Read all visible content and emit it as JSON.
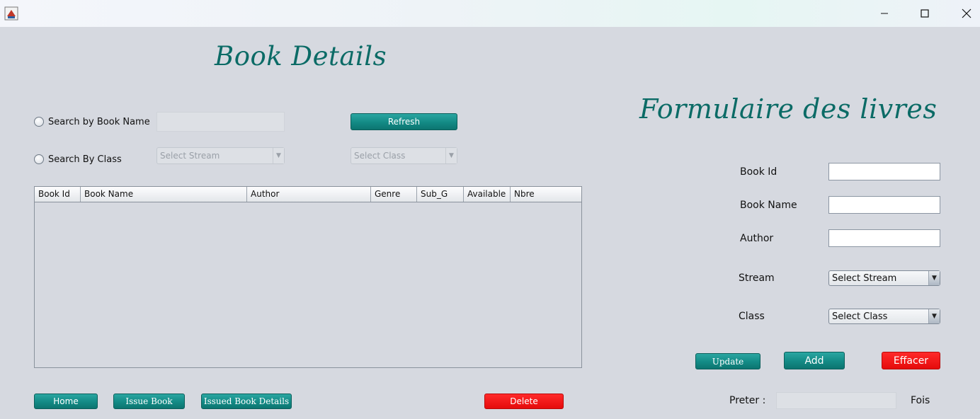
{
  "window": {
    "icons": {
      "app": "java-app-icon",
      "minimize": "minimize-icon",
      "maximize": "maximize-icon",
      "close": "close-icon"
    }
  },
  "left": {
    "heading": "Book Details",
    "search_by_name_label": "Search by Book Name",
    "search_by_class_label": "Search By Class",
    "refresh_label": "Refresh",
    "stream_combo": "Select Stream",
    "class_combo": "Select Class",
    "table": {
      "columns": [
        "Book Id",
        "Book Name",
        "Author",
        "Genre",
        "Sub_G",
        "Available",
        "Nbre"
      ],
      "rows": []
    },
    "home_label": "Home",
    "issue_book_label": "Issue Book",
    "issued_details_label": "Issued Book Details",
    "delete_label": "Delete"
  },
  "right": {
    "heading": "Formulaire des livres",
    "book_id_label": "Book Id",
    "book_name_label": "Book Name",
    "author_label": "Author",
    "stream_label": "Stream",
    "stream_value": "Select Stream",
    "class_label": "Class",
    "class_value": "Select Class",
    "update_label": "Update",
    "add_label": "Add",
    "clear_label": "Effacer",
    "preter_label": "Preter :",
    "fois_label": "Fois"
  },
  "colors": {
    "accent": "#138a85",
    "danger": "#e50b0b",
    "heading": "#0b6b66",
    "background": "#d6d9e0"
  }
}
